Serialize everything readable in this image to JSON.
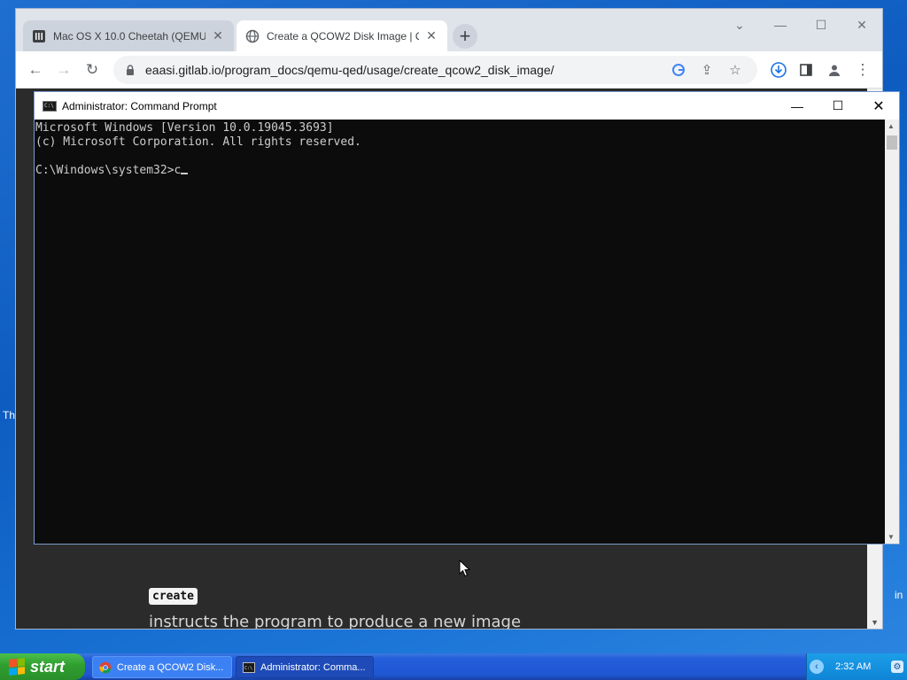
{
  "browser": {
    "tabs": [
      {
        "title": "Mac OS X 10.0 Cheetah (QEMU)",
        "icon": "museum-icon",
        "active": false
      },
      {
        "title": "Create a QCOW2 Disk Image | Q",
        "icon": "globe-icon",
        "active": true
      }
    ],
    "address_url": "eaasi.gitlab.io/program_docs/qemu-qed/usage/create_qcow2_disk_image/",
    "page": {
      "code_label": "create",
      "description": "instructs the program to produce a new image"
    }
  },
  "cmd": {
    "title": "Administrator: Command Prompt",
    "icon_text": "C:\\",
    "lines": [
      "Microsoft Windows [Version 10.0.19045.3693]",
      "(c) Microsoft Corporation. All rights reserved.",
      ""
    ],
    "prompt": "C:\\Windows\\system32>c"
  },
  "desktop": {
    "left_fragment": "Th",
    "right_fragment": "in"
  },
  "taskbar": {
    "start_label": "start",
    "tasks": [
      {
        "label": "Create a QCOW2 Disk...",
        "icon": "chrome-icon"
      },
      {
        "label": "Administrator: Comma...",
        "icon": "cmd-icon"
      }
    ],
    "clock": "2:32 AM"
  },
  "colors": {
    "desktop": "#1a6bd0",
    "taskbar": "#245edb",
    "start_button": "#2f9e2f",
    "console_bg": "#0c0c0c",
    "console_text": "#cccccc",
    "page_bg": "#2b2b2b"
  }
}
